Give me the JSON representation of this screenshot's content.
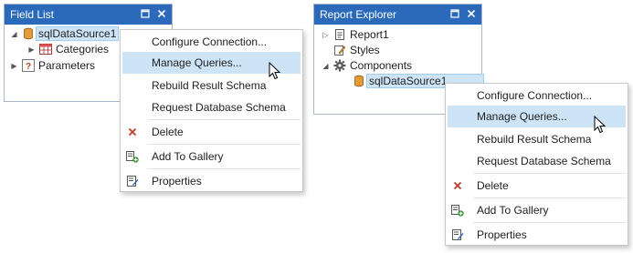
{
  "field_list": {
    "title": "Field List",
    "items": [
      {
        "label": "sqlDataSource1",
        "icon": "database-icon"
      },
      {
        "label": "Categories",
        "icon": "table-icon"
      },
      {
        "label": "Parameters",
        "icon": "parameters-icon"
      }
    ]
  },
  "report_explorer": {
    "title": "Report Explorer",
    "items": [
      {
        "label": "Report1",
        "icon": "report-icon"
      },
      {
        "label": "Styles",
        "icon": "styles-icon"
      },
      {
        "label": "Components",
        "icon": "gear-icon"
      },
      {
        "label": "sqlDataSource1",
        "icon": "database-icon"
      }
    ]
  },
  "context_menu": {
    "items": [
      {
        "label": "Configure Connection...",
        "icon": ""
      },
      {
        "label": "Manage Queries...",
        "icon": "",
        "highlighted": true
      },
      {
        "label": "Rebuild Result Schema",
        "icon": ""
      },
      {
        "label": "Request Database Schema",
        "icon": ""
      },
      {
        "label": "Delete",
        "icon": "delete-x-icon"
      },
      {
        "label": "Add To Gallery",
        "icon": "add-to-gallery-icon"
      },
      {
        "label": "Properties",
        "icon": "properties-icon"
      }
    ]
  },
  "colors": {
    "titlebar": "#2b6aba",
    "highlight": "#cde4f7",
    "delete": "#c0392b"
  }
}
